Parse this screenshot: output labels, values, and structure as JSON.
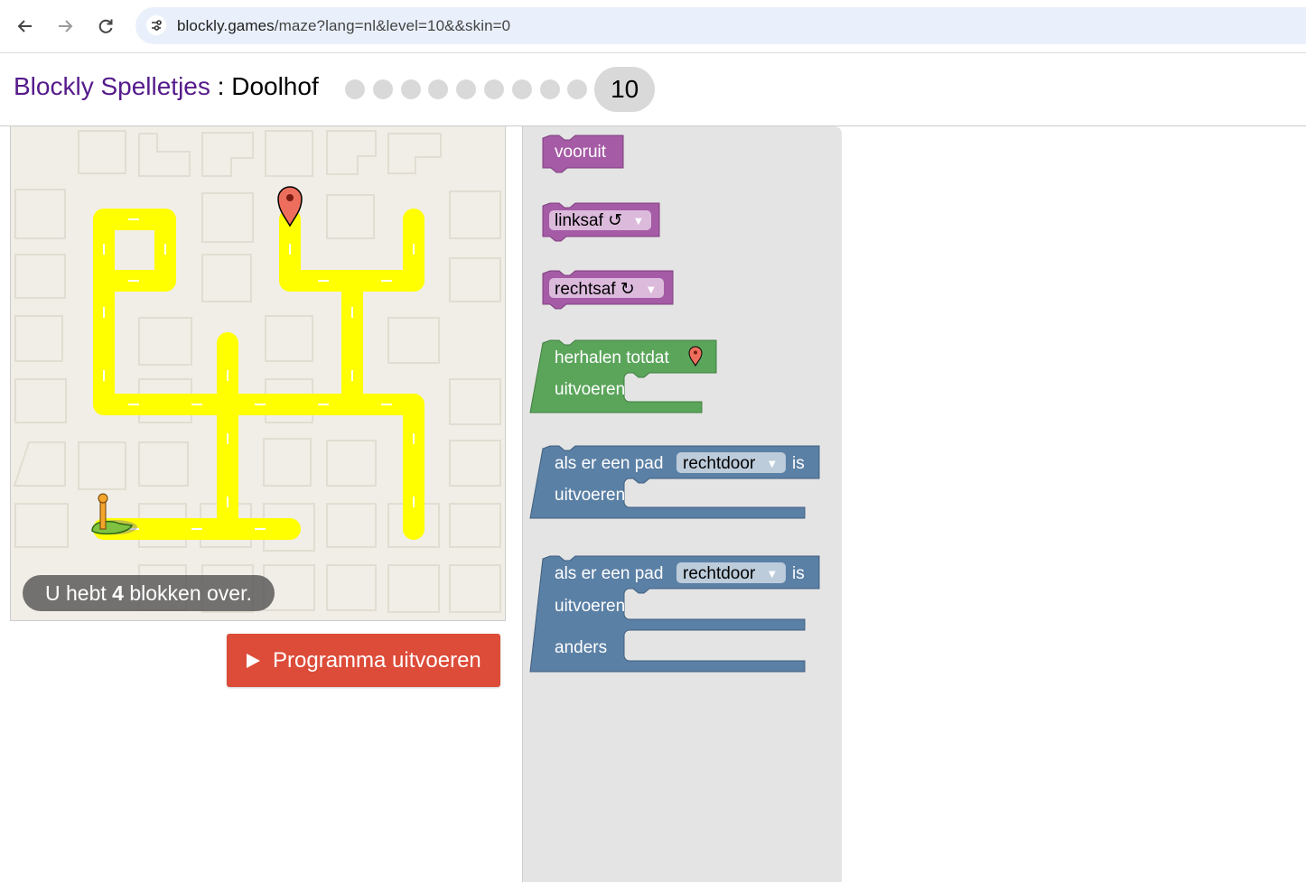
{
  "browser": {
    "url_host": "blockly.games",
    "url_path": "/maze?lang=nl&level=10&&skin=0"
  },
  "header": {
    "site_title": "Blockly Spelletjes",
    "separator": " : ",
    "page_title": "Doolhof",
    "completed_levels": 9,
    "current_level": "10"
  },
  "maze": {
    "capacity_prefix": "U hebt ",
    "capacity_count": "4",
    "capacity_suffix": " blokken over."
  },
  "run_button": {
    "label": "Programma uitvoeren"
  },
  "toolbox": {
    "move_forward": "vooruit",
    "turn_left": "linksaf ↺",
    "turn_right": "rechtsaf ↻",
    "repeat_until": "herhalen totdat",
    "do_label": "uitvoeren",
    "if_label": "als er een pad",
    "if_direction": "rechtdoor",
    "if_is": "is",
    "else_label": "anders"
  },
  "colors": {
    "movement_block": "#a55ba5",
    "loop_block": "#5ba55b",
    "logic_block": "#5b80a5",
    "run_button": "#dd4b39",
    "path": "#ffff00",
    "title_link": "#551a8b"
  }
}
